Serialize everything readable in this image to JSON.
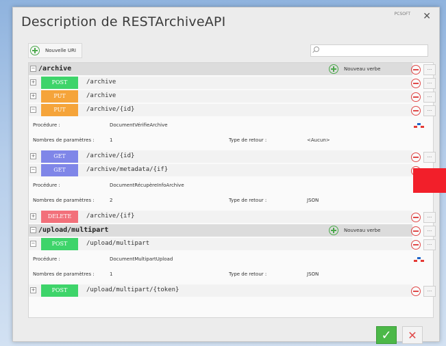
{
  "window": {
    "title": "Description de RESTArchiveAPI",
    "close_label": "✕",
    "logo_text": "PCSOFT"
  },
  "toolbar": {
    "add_uri_label": "Nouvelle URI",
    "search_placeholder": ""
  },
  "groups": [
    {
      "path": "/archive",
      "add_verb_label": "Nouveau verbe"
    },
    {
      "path": "/upload/multipart",
      "add_verb_label": "Nouveau verbe"
    }
  ],
  "apis": [
    {
      "verb": "POST",
      "path": "/archive",
      "color": "#3ed46a"
    },
    {
      "verb": "PUT",
      "path": "/archive",
      "color": "#f5a43a"
    },
    {
      "verb": "PUT",
      "path": "/archive/{id}",
      "color": "#f5a43a"
    },
    {
      "verb": "GET",
      "path": "/archive/{id}",
      "color": "#7f86e8"
    },
    {
      "verb": "GET",
      "path": "/archive/metadata/{if}",
      "color": "#7f86e8"
    },
    {
      "verb": "DELETE",
      "path": "/archive/{if}",
      "color": "#f2707a"
    },
    {
      "verb": "POST",
      "path": "/upload/multipart",
      "color": "#3ed46a"
    },
    {
      "verb": "POST",
      "path": "/upload/multipart/{token}",
      "color": "#3ed46a"
    }
  ],
  "details": [
    {
      "proc_label": "Procédure :",
      "proc_value": "DocumentVérifieArchive",
      "params_label": "Nombres de paramètres :",
      "params_value": "1",
      "ret_label": "Type de retour :",
      "ret_value": "<Aucun>"
    },
    {
      "proc_label": "Procédure :",
      "proc_value": "DocumentRécupèreInfoArchive",
      "params_label": "Nombres de paramètres :",
      "params_value": "2",
      "ret_label": "Type de retour :",
      "ret_value": "JSON"
    },
    {
      "proc_label": "Procédure :",
      "proc_value": "DocumentMultipartUpload",
      "params_label": "Nombres de paramètres :",
      "params_value": "1",
      "ret_label": "Type de retour :",
      "ret_value": "JSON"
    }
  ],
  "buttons": {
    "ok_label": "✓",
    "cancel_label": "✕",
    "more_label": "..."
  },
  "colors": {
    "post": "#3ed46a",
    "put": "#f5a43a",
    "get": "#7f86e8",
    "delete": "#f2707a",
    "accent_red": "#f21f2a"
  }
}
